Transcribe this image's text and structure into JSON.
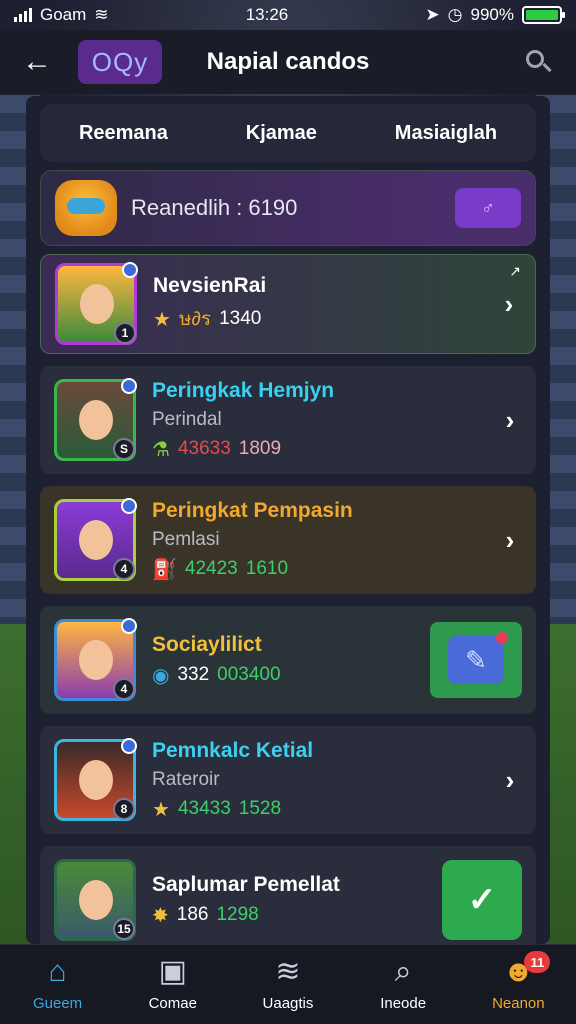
{
  "status_bar": {
    "carrier": "Goam",
    "time": "13:26",
    "battery": "990%",
    "battery_level": 0.99
  },
  "header": {
    "logo_text": "OQy",
    "title": "Napial candos",
    "search_icon": "search-icon"
  },
  "tabs": [
    {
      "label": "Reemana"
    },
    {
      "label": "Kjamae"
    },
    {
      "label": "Masiaiglah"
    }
  ],
  "current_rank": {
    "text": "Reanedlih : 6190",
    "action_icon": "sparkle-icon",
    "action_glyph": "♂"
  },
  "rows": [
    {
      "title": "NevsienRai",
      "sub": "",
      "badge": "1",
      "stat_a": "ษ∂ร",
      "stat_b": "1340",
      "stat_icon": "★",
      "action": "chevron"
    },
    {
      "title": "Peringkak Hemjyn",
      "sub": "Perindal",
      "badge": "S",
      "stat_a": "43633",
      "stat_b": "1809",
      "stat_icon": "⚗",
      "action": "chevron"
    },
    {
      "title": "Peringkat Pempasin",
      "sub": "Pemlasi",
      "badge": "4",
      "stat_a": "42423",
      "stat_b": "1610",
      "stat_icon": "⛽",
      "action": "chevron"
    },
    {
      "title": "Sociaylilict",
      "sub": "",
      "badge": "4",
      "stat_a": "332",
      "stat_b": "003400",
      "stat_icon": "◉",
      "action": "share"
    },
    {
      "title": "Pemnkalc Ketial",
      "sub": "Rateroir",
      "badge": "8",
      "stat_a": "43433",
      "stat_b": "1528",
      "stat_icon": "★",
      "action": "chevron"
    },
    {
      "title": "Saplumar Pemellat",
      "sub": "",
      "badge": "15",
      "stat_a": "186",
      "stat_b": "1298",
      "stat_icon": "✸",
      "action": "check"
    }
  ],
  "bottom_nav": [
    {
      "label": "Gueem",
      "icon": "⌂",
      "name": "home"
    },
    {
      "label": "Comae",
      "icon": "▣",
      "name": "comae"
    },
    {
      "label": "Uaagtis",
      "icon": "≋",
      "name": "uaagtis"
    },
    {
      "label": "Ineode",
      "icon": "⌕",
      "name": "ineode"
    },
    {
      "label": "Neanon",
      "icon": "☻",
      "name": "profile",
      "badge": "11"
    }
  ],
  "colors": {
    "accent_purple": "#7a3cc8",
    "accent_green": "#2eaa4e",
    "accent_blue": "#3ca8e0"
  }
}
